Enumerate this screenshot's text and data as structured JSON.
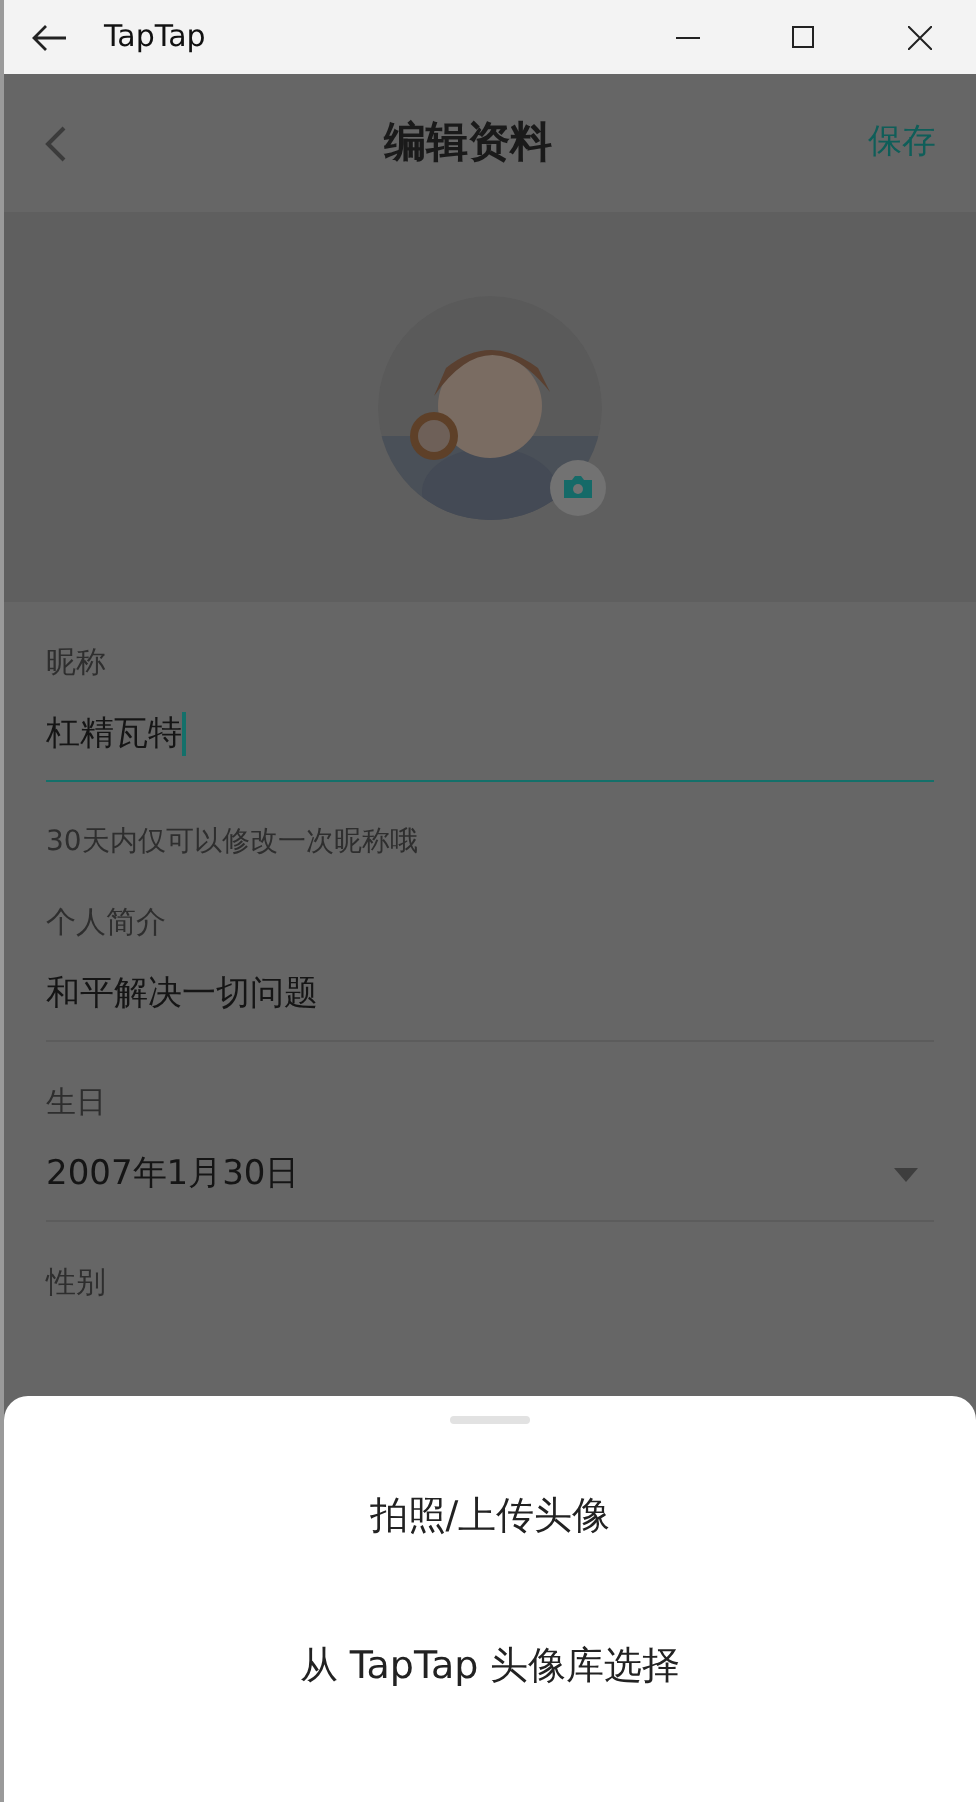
{
  "window": {
    "title": "TapTap"
  },
  "header": {
    "title": "编辑资料",
    "action": "保存"
  },
  "fields": [
    {
      "kind": "text",
      "label": "昵称",
      "value": "杠精瓦特",
      "focused": true,
      "hint": "30天内仅可以修改一次昵称哦"
    },
    {
      "kind": "text",
      "label": "个人简介",
      "value": "和平解决一切问题",
      "focused": false
    },
    {
      "kind": "select",
      "label": "生日",
      "value": "2007年1月30日"
    },
    {
      "kind": "label",
      "label": "性别"
    }
  ],
  "sheet": {
    "options": [
      "拍照/上传头像",
      "从 TapTap 头像库选择"
    ]
  }
}
